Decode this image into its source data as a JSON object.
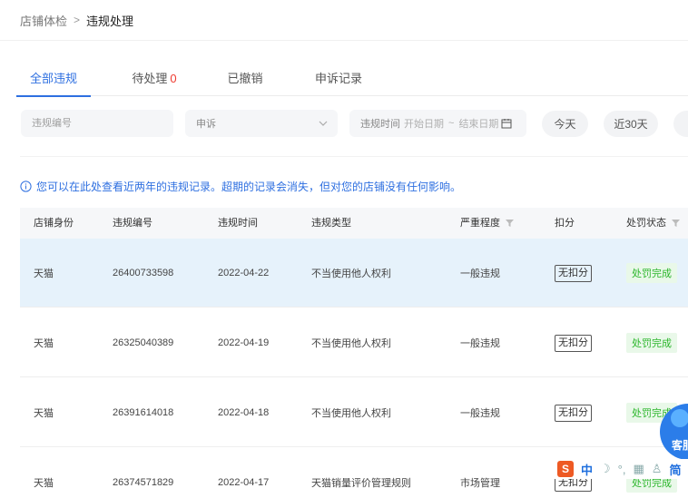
{
  "breadcrumb": {
    "parent": "店铺体检",
    "separator": ">",
    "current": "违规处理"
  },
  "tabs": [
    {
      "label": "全部违规",
      "active": true
    },
    {
      "label": "待处理",
      "count": "0"
    },
    {
      "label": "已撤销"
    },
    {
      "label": "申诉记录"
    }
  ],
  "filters": {
    "violation_no_placeholder": "违规编号",
    "type_select_value": "申诉",
    "date_label": "违规时间",
    "start_placeholder": "开始日期",
    "date_separator": "~",
    "end_placeholder": "结束日期",
    "quick_ranges": [
      "今天",
      "近30天"
    ]
  },
  "notice": "您可以在此处查看近两年的违规记录。超期的记录会消失，但对您的店铺没有任何影响。",
  "table": {
    "columns": [
      "店铺身份",
      "违规编号",
      "违规时间",
      "违规类型",
      "严重程度",
      "扣分",
      "处罚状态"
    ],
    "rows": [
      {
        "identity": "天猫",
        "number": "26400733598",
        "date": "2022-04-22",
        "type": "不当使用他人权利",
        "severity": "一般违规",
        "deduction": "无扣分",
        "status": "处罚完成"
      },
      {
        "identity": "天猫",
        "number": "26325040389",
        "date": "2022-04-19",
        "type": "不当使用他人权利",
        "severity": "一般违规",
        "deduction": "无扣分",
        "status": "处罚完成"
      },
      {
        "identity": "天猫",
        "number": "26391614018",
        "date": "2022-04-18",
        "type": "不当使用他人权利",
        "severity": "一般违规",
        "deduction": "无扣分",
        "status": "处罚完成"
      },
      {
        "identity": "天猫",
        "number": "26374571829",
        "date": "2022-04-17",
        "type": "天猫销量评价管理规则",
        "severity": "市场管理",
        "deduction": "无扣分",
        "status": "处罚完成"
      }
    ]
  },
  "customer_service": {
    "label": "客服"
  },
  "ime": {
    "logo": "S",
    "items": [
      "中",
      "简"
    ]
  },
  "colors": {
    "accent": "#2e6fe0",
    "count": "#ee3b30",
    "status_green": "#2bb62b",
    "highlight_row": "#e6f2fb"
  }
}
